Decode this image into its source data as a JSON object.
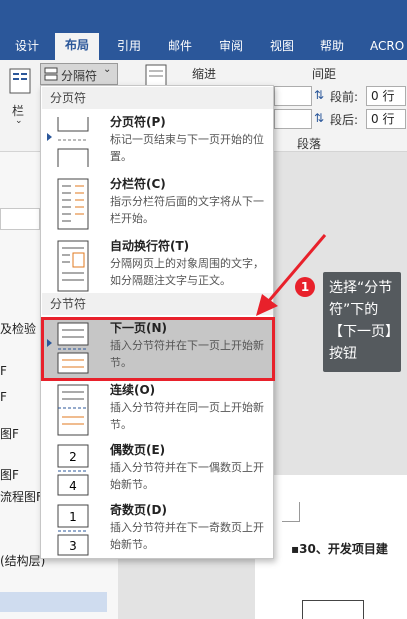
{
  "tabs": [
    "设计",
    "布局",
    "引用",
    "邮件",
    "审阅",
    "视图",
    "帮助",
    "ACRO"
  ],
  "ribbon": {
    "columns_label": "栏",
    "breaks_button": "分隔符",
    "indent_label": "缩进",
    "spacing_label": "间距",
    "before_label": "段前:",
    "before_value": "0 行",
    "after_label": "段后:",
    "after_value": "0 行",
    "paragraph_label": "段落"
  },
  "menu": {
    "page_breaks_header": "分页符",
    "section_breaks_header": "分节符",
    "items": [
      {
        "title": "分页符(P)",
        "desc": "标记一页结束与下一页开始的位置。",
        "icon": "page-break-icon"
      },
      {
        "title": "分栏符(C)",
        "desc": "指示分栏符后面的文字将从下一栏开始。",
        "icon": "column-break-icon"
      },
      {
        "title": "自动换行符(T)",
        "desc": "分隔网页上的对象周围的文字，如分隔题注文字与正文。",
        "icon": "text-wrapping-icon"
      },
      {
        "title": "下一页(N)",
        "desc": "插入分节符并在下一页上开始新节。",
        "icon": "next-page-icon"
      },
      {
        "title": "连续(O)",
        "desc": "插入分节符并在同一页上开始新节。",
        "icon": "continuous-icon"
      },
      {
        "title": "偶数页(E)",
        "desc": "插入分节符并在下一偶数页上开始新节。",
        "icon": "even-page-icon"
      },
      {
        "title": "奇数页(D)",
        "desc": "插入分节符并在下一奇数页上开始新节。",
        "icon": "odd-page-icon"
      }
    ]
  },
  "callout": {
    "badge": "1",
    "text": "选择“分节符”下的【下一页】按钮"
  },
  "nav": [
    "及检验",
    "F",
    "F",
    "图F",
    "图F",
    "流程图F",
    "(结构层)"
  ],
  "document": {
    "heading": "▪30、开发项目建"
  },
  "colors": {
    "accent": "#2b579a",
    "callout_red": "#e8212b",
    "tooltip_bg": "#555a5e"
  }
}
